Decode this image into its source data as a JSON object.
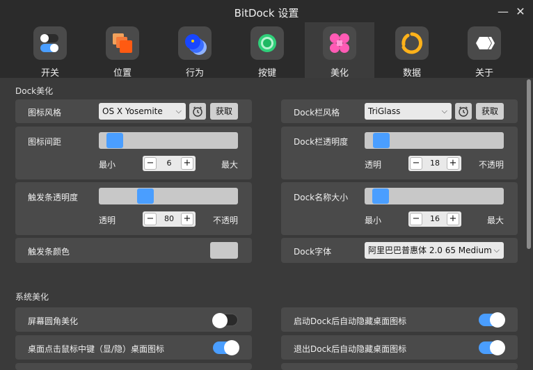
{
  "window": {
    "title": "BitDock 设置",
    "minimize_glyph": "—",
    "close_glyph": "✕"
  },
  "tabs": [
    {
      "label": "开关",
      "icon": "toggle-icon"
    },
    {
      "label": "位置",
      "icon": "position-icon"
    },
    {
      "label": "行为",
      "icon": "behavior-icon"
    },
    {
      "label": "按键",
      "icon": "key-icon"
    },
    {
      "label": "美化",
      "icon": "beautify-icon",
      "active": true
    },
    {
      "label": "数据",
      "icon": "data-icon"
    },
    {
      "label": "关于",
      "icon": "about-icon"
    }
  ],
  "dock_section": {
    "title": "Dock美化",
    "icon_style": {
      "label": "图标风格",
      "value": "OS X Yosemite",
      "fetch": "获取"
    },
    "dock_style": {
      "label": "Dock栏风格",
      "value": "TriGlass",
      "fetch": "获取"
    },
    "icon_spacing": {
      "label": "图标间距",
      "min_label": "最小",
      "max_label": "最大",
      "value": "6"
    },
    "dock_opacity": {
      "label": "Dock栏透明度",
      "min_label": "透明",
      "max_label": "不透明",
      "value": "18"
    },
    "trigger_opacity": {
      "label": "触发条透明度",
      "min_label": "透明",
      "max_label": "不透明",
      "value": "80"
    },
    "dock_name_size": {
      "label": "Dock名称大小",
      "min_label": "最小",
      "max_label": "最大",
      "value": "16"
    },
    "trigger_color": {
      "label": "触发条颜色",
      "color": "#c9c9c9"
    },
    "dock_font": {
      "label": "Dock字体",
      "value": "阿里巴巴普惠体 2.0 65 Medium"
    }
  },
  "system_section": {
    "title": "系统美化",
    "rounded_corners": {
      "label": "屏幕圆角美化",
      "on": false
    },
    "auto_hide_on_start": {
      "label": "启动Dock后自动隐藏桌面图标",
      "on": true
    },
    "middle_click_toggle": {
      "label": "桌面点击鼠标中键（显/隐）桌面图标",
      "on": true
    },
    "auto_hide_on_exit": {
      "label": "退出Dock后自动隐藏桌面图标",
      "on": true
    }
  },
  "glyphs": {
    "minus": "−",
    "plus": "+",
    "chevron": "⌵"
  },
  "colors": {
    "accent": "#4a9eff",
    "background": "#3a3a3a",
    "card": "#4a4a4a"
  }
}
